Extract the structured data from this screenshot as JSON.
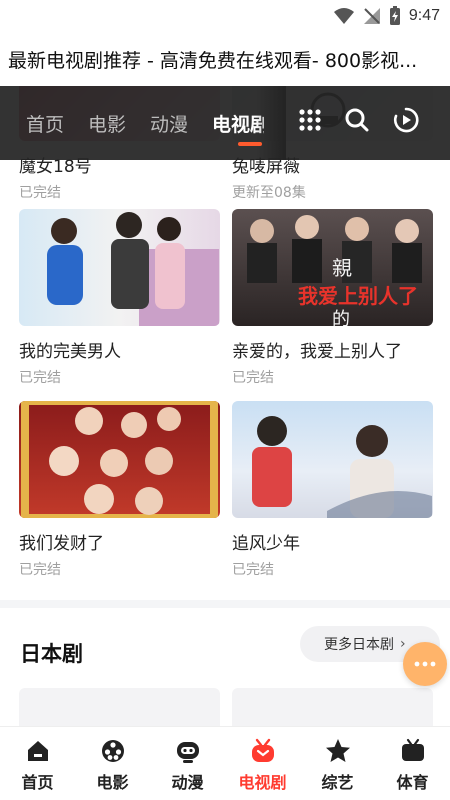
{
  "status_bar": {
    "time": "9:47"
  },
  "page_title": "最新电视剧推荐 - 高清免费在线观看- 800影视...",
  "category_nav": {
    "tabs": [
      {
        "label": "首页"
      },
      {
        "label": "电影"
      },
      {
        "label": "动漫"
      },
      {
        "label": "电视剧",
        "active": true
      }
    ],
    "icons": [
      "grid-icon",
      "search-icon",
      "play-history-icon"
    ]
  },
  "drama_cards": [
    {
      "title": "魔女18号",
      "status": "已完结"
    },
    {
      "title": "兔唛屏薇",
      "status": "更新至08集"
    },
    {
      "title": "我的完美男人",
      "status": "已完结"
    },
    {
      "title": "亲爱的，我爱上别人了",
      "status": "已完结",
      "poster_text_line1": "親",
      "poster_text_line2": "我爱上别人了",
      "poster_text_line3": "的"
    },
    {
      "title": "我们发财了",
      "status": "已完结"
    },
    {
      "title": "追风少年",
      "status": "已完结"
    }
  ],
  "japanese_section": {
    "title": "日本剧",
    "more_label": "更多日本剧"
  },
  "bottom_nav": [
    {
      "label": "首页",
      "icon": "home-icon"
    },
    {
      "label": "电影",
      "icon": "film-reel-icon"
    },
    {
      "label": "动漫",
      "icon": "anime-face-icon"
    },
    {
      "label": "电视剧",
      "icon": "tv-icon",
      "active": true
    },
    {
      "label": "综艺",
      "icon": "star-icon"
    },
    {
      "label": "体育",
      "icon": "sports-tv-icon"
    }
  ],
  "colors": {
    "accent": "#ff3b30",
    "underline": "#ff5b2e",
    "fab": "#ffb46a",
    "nav_bg": "#232323"
  }
}
